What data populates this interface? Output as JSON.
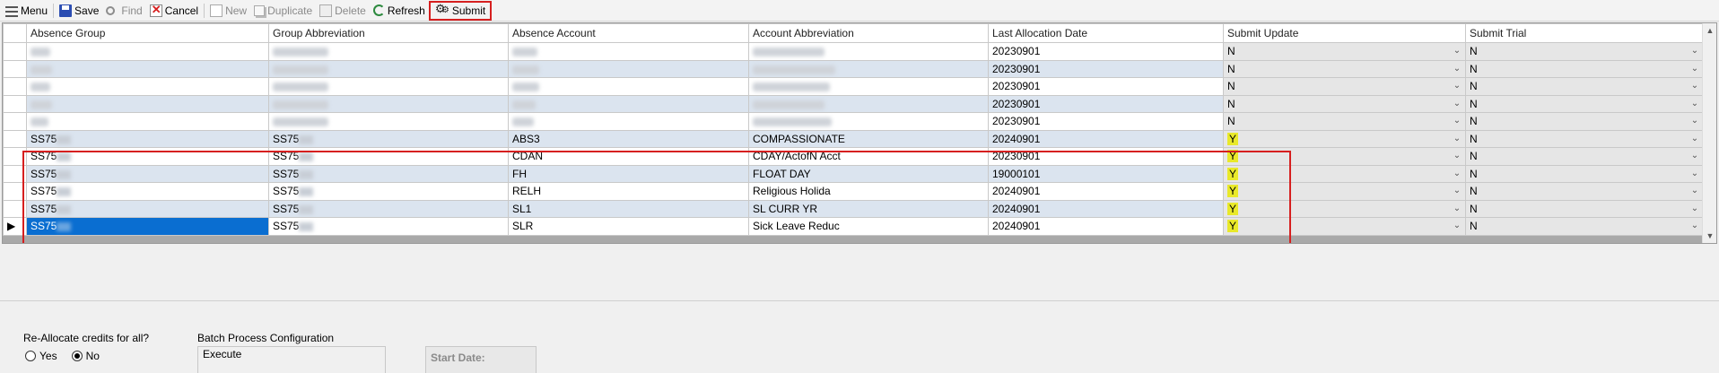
{
  "toolbar": {
    "menu": "Menu",
    "save": "Save",
    "find": "Find",
    "cancel": "Cancel",
    "new": "New",
    "duplicate": "Duplicate",
    "delete": "Delete",
    "refresh": "Refresh",
    "submit": "Submit"
  },
  "grid": {
    "columns": [
      "Absence Group",
      "Group Abbreviation",
      "Absence Account",
      "Account Abbreviation",
      "Last Allocation Date",
      "Submit Update",
      "Submit Trial"
    ],
    "rows": [
      {
        "absence_group": "",
        "group_abbreviation": "",
        "absence_account": "",
        "account_abbreviation": "",
        "last_allocation_date": "20230901",
        "submit_update": "N",
        "submit_trial": "N"
      },
      {
        "absence_group": "",
        "group_abbreviation": "",
        "absence_account": "",
        "account_abbreviation": "",
        "last_allocation_date": "20230901",
        "submit_update": "N",
        "submit_trial": "N"
      },
      {
        "absence_group": "",
        "group_abbreviation": "",
        "absence_account": "",
        "account_abbreviation": "",
        "last_allocation_date": "20230901",
        "submit_update": "N",
        "submit_trial": "N"
      },
      {
        "absence_group": "",
        "group_abbreviation": "",
        "absence_account": "",
        "account_abbreviation": "",
        "last_allocation_date": "20230901",
        "submit_update": "N",
        "submit_trial": "N"
      },
      {
        "absence_group": "",
        "group_abbreviation": "",
        "absence_account": "",
        "account_abbreviation": "",
        "last_allocation_date": "20230901",
        "submit_update": "N",
        "submit_trial": "N"
      },
      {
        "absence_group": "SS75",
        "group_abbreviation": "SS75",
        "absence_account": "ABS3",
        "account_abbreviation": "COMPASSIONATE",
        "last_allocation_date": "20240901",
        "submit_update": "Y",
        "submit_trial": "N"
      },
      {
        "absence_group": "SS75",
        "group_abbreviation": "SS75",
        "absence_account": "CDAN",
        "account_abbreviation": "CDAY/ActofN Acct",
        "last_allocation_date": "20230901",
        "submit_update": "Y",
        "submit_trial": "N"
      },
      {
        "absence_group": "SS75",
        "group_abbreviation": "SS75",
        "absence_account": "FH",
        "account_abbreviation": "FLOAT DAY",
        "last_allocation_date": "19000101",
        "submit_update": "Y",
        "submit_trial": "N"
      },
      {
        "absence_group": "SS75",
        "group_abbreviation": "SS75",
        "absence_account": "RELH",
        "account_abbreviation": "Religious Holida",
        "last_allocation_date": "20240901",
        "submit_update": "Y",
        "submit_trial": "N"
      },
      {
        "absence_group": "SS75",
        "group_abbreviation": "SS75",
        "absence_account": "SL1",
        "account_abbreviation": "SL CURR YR",
        "last_allocation_date": "20240901",
        "submit_update": "Y",
        "submit_trial": "N"
      },
      {
        "absence_group": "SS75",
        "group_abbreviation": "SS75",
        "absence_account": "SLR",
        "account_abbreviation": "Sick Leave Reduc",
        "last_allocation_date": "20240901",
        "submit_update": "Y",
        "submit_trial": "N"
      }
    ]
  },
  "reallocate": {
    "title": "Re-Allocate credits for all?",
    "yes": "Yes",
    "no": "No",
    "selected": "No"
  },
  "batch": {
    "title": "Batch Process Configuration",
    "execute": "Execute",
    "start_date": "Start Date:"
  },
  "colors": {
    "selection": "#0a6ed1",
    "highlight_y": "#e9e92a",
    "alt_row": "#dbe4ef",
    "annotation_red": "#d61f1f"
  }
}
